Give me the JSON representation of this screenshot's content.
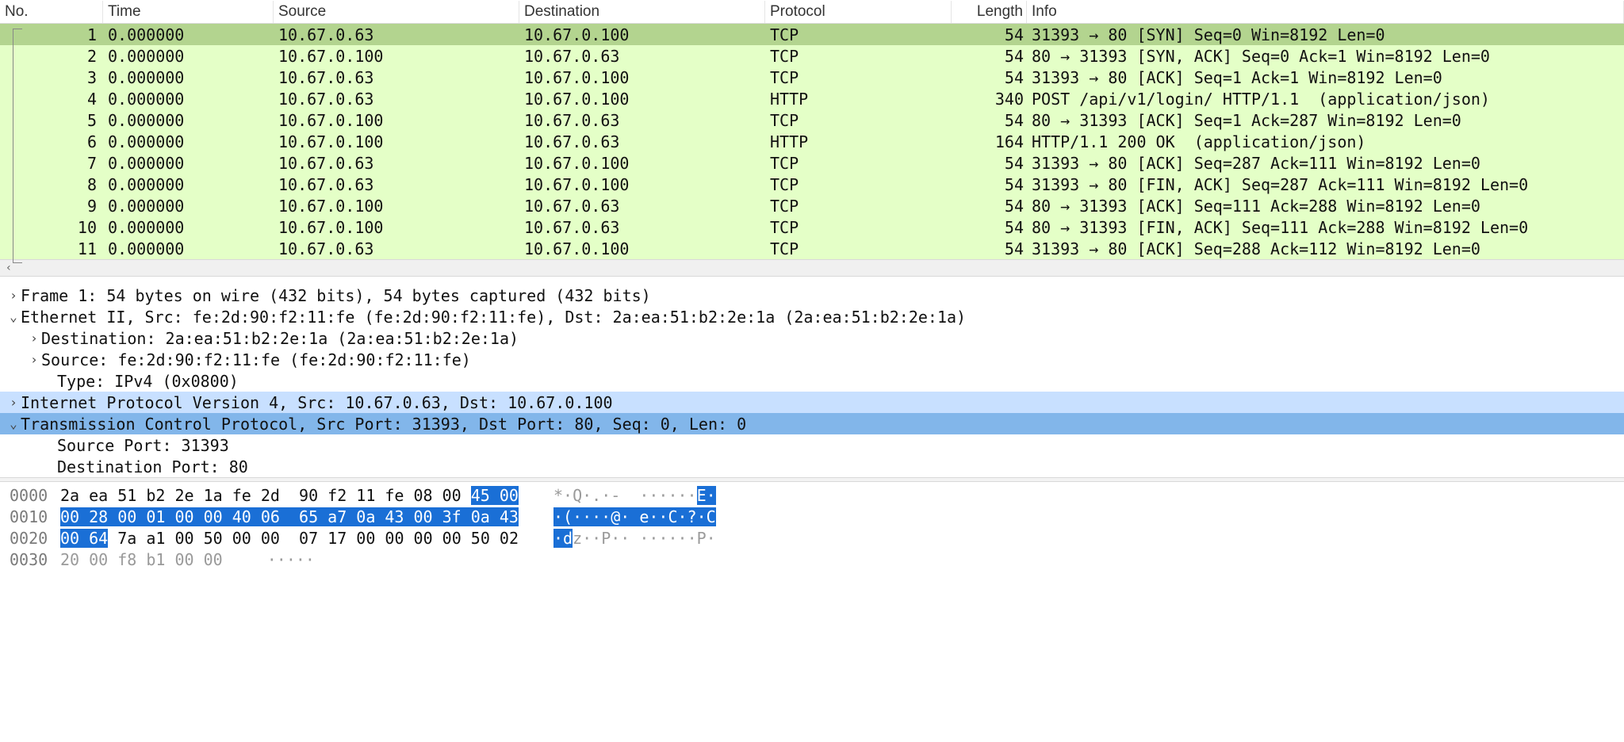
{
  "columns": {
    "no": "No.",
    "time": "Time",
    "src": "Source",
    "dst": "Destination",
    "proto": "Protocol",
    "len": "Length",
    "info": "Info"
  },
  "packets": [
    {
      "no": "1",
      "time": "0.000000",
      "src": "10.67.0.63",
      "dst": "10.67.0.100",
      "proto": "TCP",
      "len": "54",
      "info": "31393 → 80 [SYN] Seq=0 Win=8192 Len=0",
      "sel": true
    },
    {
      "no": "2",
      "time": "0.000000",
      "src": "10.67.0.100",
      "dst": "10.67.0.63",
      "proto": "TCP",
      "len": "54",
      "info": "80 → 31393 [SYN, ACK] Seq=0 Ack=1 Win=8192 Len=0"
    },
    {
      "no": "3",
      "time": "0.000000",
      "src": "10.67.0.63",
      "dst": "10.67.0.100",
      "proto": "TCP",
      "len": "54",
      "info": "31393 → 80 [ACK] Seq=1 Ack=1 Win=8192 Len=0"
    },
    {
      "no": "4",
      "time": "0.000000",
      "src": "10.67.0.63",
      "dst": "10.67.0.100",
      "proto": "HTTP",
      "len": "340",
      "info": "POST /api/v1/login/ HTTP/1.1  (application/json)"
    },
    {
      "no": "5",
      "time": "0.000000",
      "src": "10.67.0.100",
      "dst": "10.67.0.63",
      "proto": "TCP",
      "len": "54",
      "info": "80 → 31393 [ACK] Seq=1 Ack=287 Win=8192 Len=0"
    },
    {
      "no": "6",
      "time": "0.000000",
      "src": "10.67.0.100",
      "dst": "10.67.0.63",
      "proto": "HTTP",
      "len": "164",
      "info": "HTTP/1.1 200 OK  (application/json)"
    },
    {
      "no": "7",
      "time": "0.000000",
      "src": "10.67.0.63",
      "dst": "10.67.0.100",
      "proto": "TCP",
      "len": "54",
      "info": "31393 → 80 [ACK] Seq=287 Ack=111 Win=8192 Len=0"
    },
    {
      "no": "8",
      "time": "0.000000",
      "src": "10.67.0.63",
      "dst": "10.67.0.100",
      "proto": "TCP",
      "len": "54",
      "info": "31393 → 80 [FIN, ACK] Seq=287 Ack=111 Win=8192 Len=0"
    },
    {
      "no": "9",
      "time": "0.000000",
      "src": "10.67.0.100",
      "dst": "10.67.0.63",
      "proto": "TCP",
      "len": "54",
      "info": "80 → 31393 [ACK] Seq=111 Ack=288 Win=8192 Len=0"
    },
    {
      "no": "10",
      "time": "0.000000",
      "src": "10.67.0.100",
      "dst": "10.67.0.63",
      "proto": "TCP",
      "len": "54",
      "info": "80 → 31393 [FIN, ACK] Seq=111 Ack=288 Win=8192 Len=0"
    },
    {
      "no": "11",
      "time": "0.000000",
      "src": "10.67.0.63",
      "dst": "10.67.0.100",
      "proto": "TCP",
      "len": "54",
      "info": "31393 → 80 [ACK] Seq=288 Ack=112 Win=8192 Len=0"
    }
  ],
  "tree": {
    "frame": "Frame 1: 54 bytes on wire (432 bits), 54 bytes captured (432 bits)",
    "eth": "Ethernet II, Src: fe:2d:90:f2:11:fe (fe:2d:90:f2:11:fe), Dst: 2a:ea:51:b2:2e:1a (2a:ea:51:b2:2e:1a)",
    "eth_dst": "Destination: 2a:ea:51:b2:2e:1a (2a:ea:51:b2:2e:1a)",
    "eth_src": "Source: fe:2d:90:f2:11:fe (fe:2d:90:f2:11:fe)",
    "eth_type": "Type: IPv4 (0x0800)",
    "ip": "Internet Protocol Version 4, Src: 10.67.0.63, Dst: 10.67.0.100",
    "tcp": "Transmission Control Protocol, Src Port: 31393, Dst Port: 80, Seq: 0, Len: 0",
    "tcp_src": "Source Port: 31393",
    "tcp_dst": "Destination Port: 80"
  },
  "hex": {
    "r0_off": "0000",
    "r0_a": "2a ea 51 b2 2e 1a fe 2d  90 f2 11 fe 08 00 ",
    "r0_hl": "45 00",
    "r0_asc_a": "*·Q·.·-  ······",
    "r0_asc_hl": "E·",
    "r1_off": "0010",
    "r1_hl": "00 28 00 01 00 00 40 06  65 a7 0a 43 00 3f 0a 43",
    "r1_asc_hl": "·(····@· e··C·?·C",
    "r2_off": "0020",
    "r2_hl": "00 64",
    "r2_a": " 7a a1 00 50 00 00  07 17 00 00 00 00 50 02",
    "r2_asc_hl": "·d",
    "r2_asc_a": "z··P·· ······P·",
    "r3_off": "0030",
    "r3_a": "20 00 f8 b1 00 00",
    "r3_asc": " ·····"
  },
  "glyph": {
    "right": "›",
    "down": "⌄",
    "left": "‹"
  }
}
